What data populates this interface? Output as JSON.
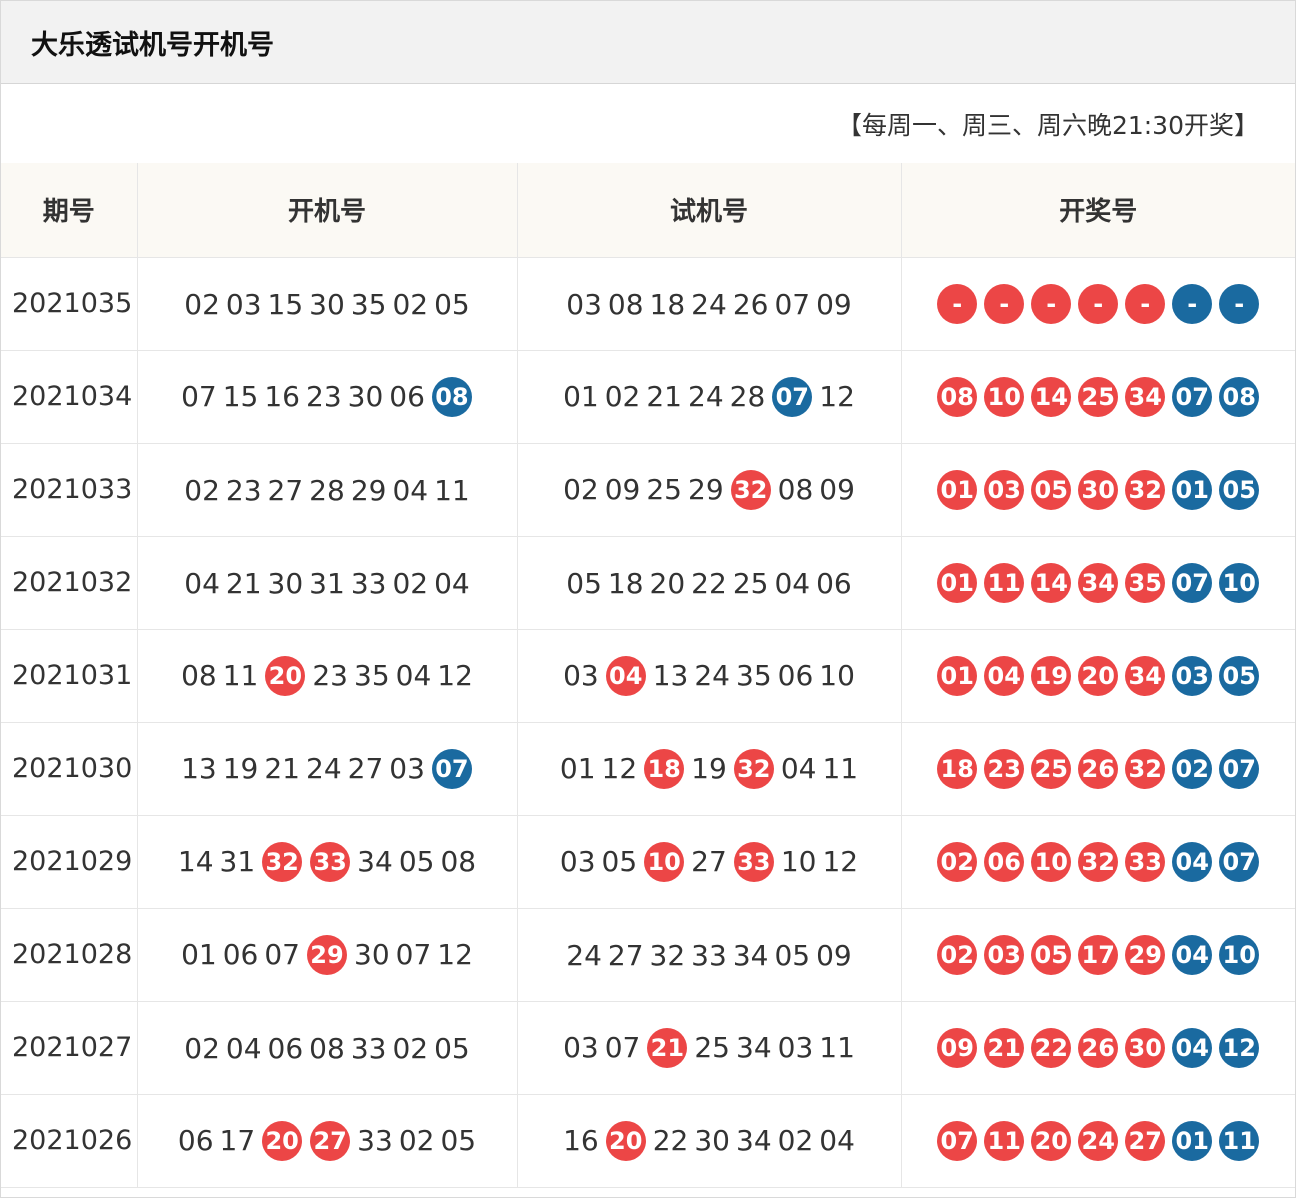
{
  "title": "大乐透试机号开机号",
  "note": "【每周一、周三、周六晚21:30开奖】",
  "headers": [
    "期号",
    "开机号",
    "试机号",
    "开奖号"
  ],
  "colors": {
    "red_ball": "#ec4646",
    "blue_ball": "#1a6aa0"
  },
  "rows": [
    {
      "issue": "2021035",
      "open": [
        [
          "02",
          ""
        ],
        [
          "03",
          ""
        ],
        [
          "15",
          ""
        ],
        [
          "30",
          ""
        ],
        [
          "35",
          ""
        ],
        [
          "02",
          ""
        ],
        [
          "05",
          ""
        ]
      ],
      "trial": [
        [
          "03",
          ""
        ],
        [
          "08",
          ""
        ],
        [
          "18",
          ""
        ],
        [
          "24",
          ""
        ],
        [
          "26",
          ""
        ],
        [
          "07",
          ""
        ],
        [
          "09",
          ""
        ]
      ],
      "draw": [
        [
          "-",
          "red"
        ],
        [
          "-",
          "red"
        ],
        [
          "-",
          "red"
        ],
        [
          "-",
          "red"
        ],
        [
          "-",
          "red"
        ],
        [
          "-",
          "blue"
        ],
        [
          "-",
          "blue"
        ]
      ]
    },
    {
      "issue": "2021034",
      "open": [
        [
          "07",
          ""
        ],
        [
          "15",
          ""
        ],
        [
          "16",
          ""
        ],
        [
          "23",
          ""
        ],
        [
          "30",
          ""
        ],
        [
          "06",
          ""
        ],
        [
          "08",
          "blue"
        ]
      ],
      "trial": [
        [
          "01",
          ""
        ],
        [
          "02",
          ""
        ],
        [
          "21",
          ""
        ],
        [
          "24",
          ""
        ],
        [
          "28",
          ""
        ],
        [
          "07",
          "blue"
        ],
        [
          "12",
          ""
        ]
      ],
      "draw": [
        [
          "08",
          "red"
        ],
        [
          "10",
          "red"
        ],
        [
          "14",
          "red"
        ],
        [
          "25",
          "red"
        ],
        [
          "34",
          "red"
        ],
        [
          "07",
          "blue"
        ],
        [
          "08",
          "blue"
        ]
      ]
    },
    {
      "issue": "2021033",
      "open": [
        [
          "02",
          ""
        ],
        [
          "23",
          ""
        ],
        [
          "27",
          ""
        ],
        [
          "28",
          ""
        ],
        [
          "29",
          ""
        ],
        [
          "04",
          ""
        ],
        [
          "11",
          ""
        ]
      ],
      "trial": [
        [
          "02",
          ""
        ],
        [
          "09",
          ""
        ],
        [
          "25",
          ""
        ],
        [
          "29",
          ""
        ],
        [
          "32",
          "red"
        ],
        [
          "08",
          ""
        ],
        [
          "09",
          ""
        ]
      ],
      "draw": [
        [
          "01",
          "red"
        ],
        [
          "03",
          "red"
        ],
        [
          "05",
          "red"
        ],
        [
          "30",
          "red"
        ],
        [
          "32",
          "red"
        ],
        [
          "01",
          "blue"
        ],
        [
          "05",
          "blue"
        ]
      ]
    },
    {
      "issue": "2021032",
      "open": [
        [
          "04",
          ""
        ],
        [
          "21",
          ""
        ],
        [
          "30",
          ""
        ],
        [
          "31",
          ""
        ],
        [
          "33",
          ""
        ],
        [
          "02",
          ""
        ],
        [
          "04",
          ""
        ]
      ],
      "trial": [
        [
          "05",
          ""
        ],
        [
          "18",
          ""
        ],
        [
          "20",
          ""
        ],
        [
          "22",
          ""
        ],
        [
          "25",
          ""
        ],
        [
          "04",
          ""
        ],
        [
          "06",
          ""
        ]
      ],
      "draw": [
        [
          "01",
          "red"
        ],
        [
          "11",
          "red"
        ],
        [
          "14",
          "red"
        ],
        [
          "34",
          "red"
        ],
        [
          "35",
          "red"
        ],
        [
          "07",
          "blue"
        ],
        [
          "10",
          "blue"
        ]
      ]
    },
    {
      "issue": "2021031",
      "open": [
        [
          "08",
          ""
        ],
        [
          "11",
          ""
        ],
        [
          "20",
          "red"
        ],
        [
          "23",
          ""
        ],
        [
          "35",
          ""
        ],
        [
          "04",
          ""
        ],
        [
          "12",
          ""
        ]
      ],
      "trial": [
        [
          "03",
          ""
        ],
        [
          "04",
          "red"
        ],
        [
          "13",
          ""
        ],
        [
          "24",
          ""
        ],
        [
          "35",
          ""
        ],
        [
          "06",
          ""
        ],
        [
          "10",
          ""
        ]
      ],
      "draw": [
        [
          "01",
          "red"
        ],
        [
          "04",
          "red"
        ],
        [
          "19",
          "red"
        ],
        [
          "20",
          "red"
        ],
        [
          "34",
          "red"
        ],
        [
          "03",
          "blue"
        ],
        [
          "05",
          "blue"
        ]
      ]
    },
    {
      "issue": "2021030",
      "open": [
        [
          "13",
          ""
        ],
        [
          "19",
          ""
        ],
        [
          "21",
          ""
        ],
        [
          "24",
          ""
        ],
        [
          "27",
          ""
        ],
        [
          "03",
          ""
        ],
        [
          "07",
          "blue"
        ]
      ],
      "trial": [
        [
          "01",
          ""
        ],
        [
          "12",
          ""
        ],
        [
          "18",
          "red"
        ],
        [
          "19",
          ""
        ],
        [
          "32",
          "red"
        ],
        [
          "04",
          ""
        ],
        [
          "11",
          ""
        ]
      ],
      "draw": [
        [
          "18",
          "red"
        ],
        [
          "23",
          "red"
        ],
        [
          "25",
          "red"
        ],
        [
          "26",
          "red"
        ],
        [
          "32",
          "red"
        ],
        [
          "02",
          "blue"
        ],
        [
          "07",
          "blue"
        ]
      ]
    },
    {
      "issue": "2021029",
      "open": [
        [
          "14",
          ""
        ],
        [
          "31",
          ""
        ],
        [
          "32",
          "red"
        ],
        [
          "33",
          "red"
        ],
        [
          "34",
          ""
        ],
        [
          "05",
          ""
        ],
        [
          "08",
          ""
        ]
      ],
      "trial": [
        [
          "03",
          ""
        ],
        [
          "05",
          ""
        ],
        [
          "10",
          "red"
        ],
        [
          "27",
          ""
        ],
        [
          "33",
          "red"
        ],
        [
          "10",
          ""
        ],
        [
          "12",
          ""
        ]
      ],
      "draw": [
        [
          "02",
          "red"
        ],
        [
          "06",
          "red"
        ],
        [
          "10",
          "red"
        ],
        [
          "32",
          "red"
        ],
        [
          "33",
          "red"
        ],
        [
          "04",
          "blue"
        ],
        [
          "07",
          "blue"
        ]
      ]
    },
    {
      "issue": "2021028",
      "open": [
        [
          "01",
          ""
        ],
        [
          "06",
          ""
        ],
        [
          "07",
          ""
        ],
        [
          "29",
          "red"
        ],
        [
          "30",
          ""
        ],
        [
          "07",
          ""
        ],
        [
          "12",
          ""
        ]
      ],
      "trial": [
        [
          "24",
          ""
        ],
        [
          "27",
          ""
        ],
        [
          "32",
          ""
        ],
        [
          "33",
          ""
        ],
        [
          "34",
          ""
        ],
        [
          "05",
          ""
        ],
        [
          "09",
          ""
        ]
      ],
      "draw": [
        [
          "02",
          "red"
        ],
        [
          "03",
          "red"
        ],
        [
          "05",
          "red"
        ],
        [
          "17",
          "red"
        ],
        [
          "29",
          "red"
        ],
        [
          "04",
          "blue"
        ],
        [
          "10",
          "blue"
        ]
      ]
    },
    {
      "issue": "2021027",
      "open": [
        [
          "02",
          ""
        ],
        [
          "04",
          ""
        ],
        [
          "06",
          ""
        ],
        [
          "08",
          ""
        ],
        [
          "33",
          ""
        ],
        [
          "02",
          ""
        ],
        [
          "05",
          ""
        ]
      ],
      "trial": [
        [
          "03",
          ""
        ],
        [
          "07",
          ""
        ],
        [
          "21",
          "red"
        ],
        [
          "25",
          ""
        ],
        [
          "34",
          ""
        ],
        [
          "03",
          ""
        ],
        [
          "11",
          ""
        ]
      ],
      "draw": [
        [
          "09",
          "red"
        ],
        [
          "21",
          "red"
        ],
        [
          "22",
          "red"
        ],
        [
          "26",
          "red"
        ],
        [
          "30",
          "red"
        ],
        [
          "04",
          "blue"
        ],
        [
          "12",
          "blue"
        ]
      ]
    },
    {
      "issue": "2021026",
      "open": [
        [
          "06",
          ""
        ],
        [
          "17",
          ""
        ],
        [
          "20",
          "red"
        ],
        [
          "27",
          "red"
        ],
        [
          "33",
          ""
        ],
        [
          "02",
          ""
        ],
        [
          "05",
          ""
        ]
      ],
      "trial": [
        [
          "16",
          ""
        ],
        [
          "20",
          "red"
        ],
        [
          "22",
          ""
        ],
        [
          "30",
          ""
        ],
        [
          "34",
          ""
        ],
        [
          "02",
          ""
        ],
        [
          "04",
          ""
        ]
      ],
      "draw": [
        [
          "07",
          "red"
        ],
        [
          "11",
          "red"
        ],
        [
          "20",
          "red"
        ],
        [
          "24",
          "red"
        ],
        [
          "27",
          "red"
        ],
        [
          "01",
          "blue"
        ],
        [
          "11",
          "blue"
        ]
      ]
    }
  ]
}
